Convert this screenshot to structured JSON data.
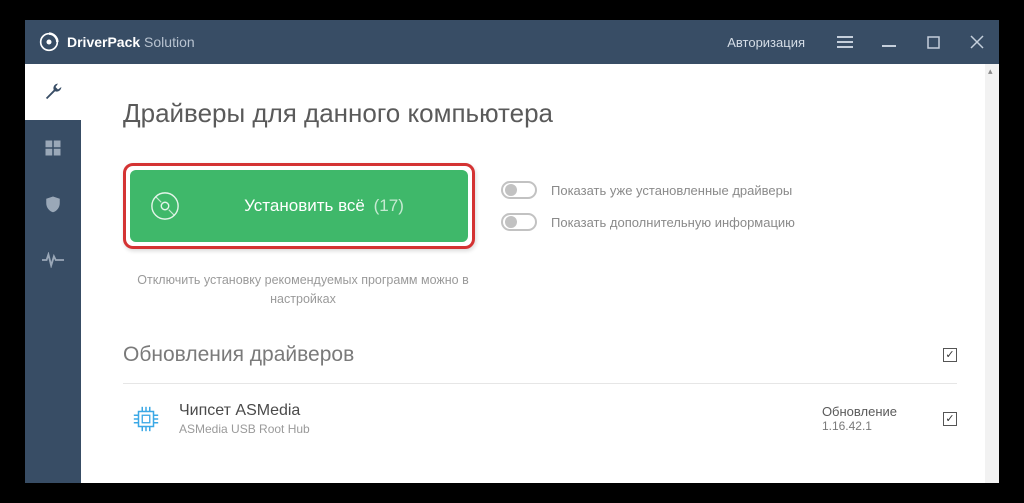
{
  "titlebar": {
    "brand_bold": "DriverPack",
    "brand_light": " Solution",
    "auth": "Авторизация"
  },
  "page": {
    "title": "Драйверы для данного компьютера"
  },
  "install": {
    "label": "Установить всё",
    "count": "(17)"
  },
  "toggles": {
    "show_installed": "Показать уже установленные драйверы",
    "show_more": "Показать дополнительную информацию"
  },
  "hint": "Отключить установку рекомендуемых программ можно в настройках",
  "section": {
    "updates": "Обновления драйверов"
  },
  "driver": {
    "name": "Чипсет ASMedia",
    "sub": "ASMedia USB Root Hub",
    "status": "Обновление",
    "version": "1.16.42.1"
  }
}
